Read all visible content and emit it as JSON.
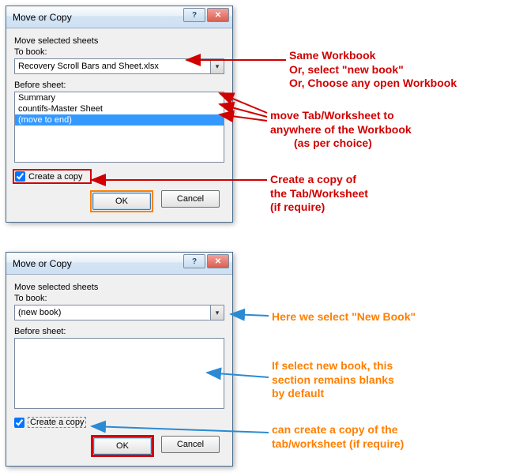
{
  "dialog1": {
    "title": "Move or Copy",
    "instr": "Move selected sheets",
    "to_book_label": "To book:",
    "to_book_value": "Recovery Scroll Bars and Sheet.xlsx",
    "before_label": "Before sheet:",
    "items": [
      "Summary",
      "countifs-Master Sheet",
      "(move to end)"
    ],
    "selected_index": 2,
    "copy_label": "Create a copy",
    "copy_checked": true,
    "ok": "OK",
    "cancel": "Cancel"
  },
  "dialog2": {
    "title": "Move or Copy",
    "instr": "Move selected sheets",
    "to_book_label": "To book:",
    "to_book_value": "(new book)",
    "before_label": "Before sheet:",
    "items": [],
    "copy_label": "Create a copy",
    "copy_checked": true,
    "ok": "OK",
    "cancel": "Cancel"
  },
  "annot": {
    "a1l1": "Same Workbook",
    "a1l2": "Or, select \"new book\"",
    "a1l3": "Or, Choose any open Workbook",
    "a2l1": "move Tab/Worksheet to",
    "a2l2": "anywhere of the Workbook",
    "a2l3": "(as per choice)",
    "a3l1": "Create a copy of",
    "a3l2": "the Tab/Worksheet",
    "a3l3": "(if require)",
    "b1": "Here we select \"New Book\"",
    "b2l1": "If select new book, this",
    "b2l2": "section remains blanks",
    "b2l3": "by default",
    "b3l1": "can create a copy of the",
    "b3l2": "tab/worksheet (if require)"
  }
}
